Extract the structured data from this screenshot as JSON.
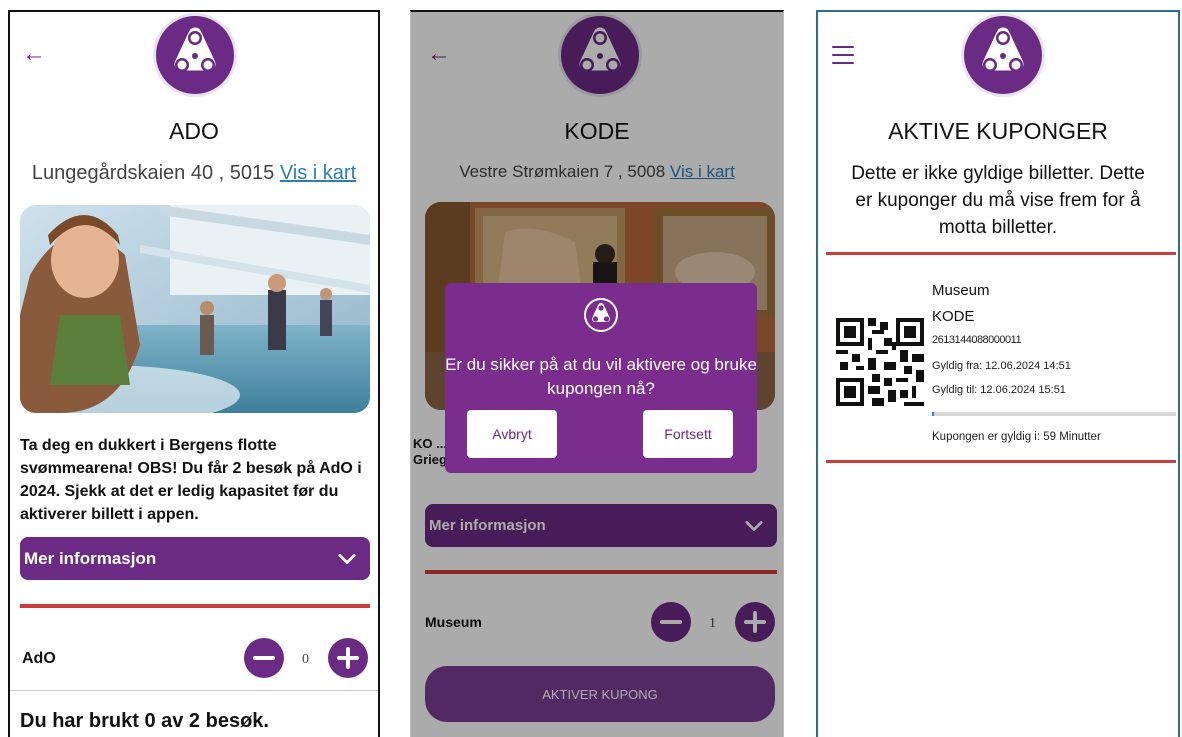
{
  "panels": {
    "ado": {
      "title": "ADO",
      "address": "Lungegårdskaien 40 , 5015",
      "map_link": "Vis i kart",
      "description": "Ta deg en dukkert i Bergens flotte svømmearena! OBS! Du får 2 besøk på AdO i 2024. Sjekk at det er ledig kapasitet før du aktiverer billett i appen.",
      "more_info": "Mer informasjon",
      "item_label": "AdO",
      "count": "0",
      "usage": "Du har brukt 0 av 2 besøk."
    },
    "kode": {
      "title": "KODE",
      "address": "Vestre Strømkaien 7 , 5008",
      "map_link": "Vis i kart",
      "description_partial": "KO ... ko... kunstnere som Edvard Munch og Edvard Grieg.",
      "more_info": "Mer informasjon",
      "item_label": "Museum",
      "count": "1",
      "activate_button": "AKTIVER KUPONG",
      "dialog": {
        "message": "Er du sikker på at du vil aktivere og bruke kupongen nå?",
        "cancel": "Avbryt",
        "confirm": "Fortsett"
      }
    },
    "coupons": {
      "title": "AKTIVE KUPONGER",
      "note": "Dette er ikke gyldige billetter. Dette er kuponger du må vise frem for å motta billetter.",
      "coupon": {
        "category": "Museum",
        "name": "KODE",
        "code": "2613144088000011",
        "valid_from": "Gyldig fra: 12.06.2024 14:51",
        "valid_to": "Gyldig til: 12.06.2024 15:51",
        "valid_in": "Kupongen er gyldig i:  59 Minutter",
        "progress": 0.01
      }
    }
  },
  "colors": {
    "brand_purple": "#6b2a84",
    "accent_red": "#d23b3b",
    "link_blue": "#2c7fb8"
  },
  "icons": {
    "back": "arrow-left-icon",
    "menu": "hamburger-menu-icon",
    "logo": "fidget-spinner-logo",
    "chevron": "chevron-down-icon",
    "minus": "minus-circle-icon",
    "plus": "plus-circle-icon",
    "qr": "qr-code"
  }
}
